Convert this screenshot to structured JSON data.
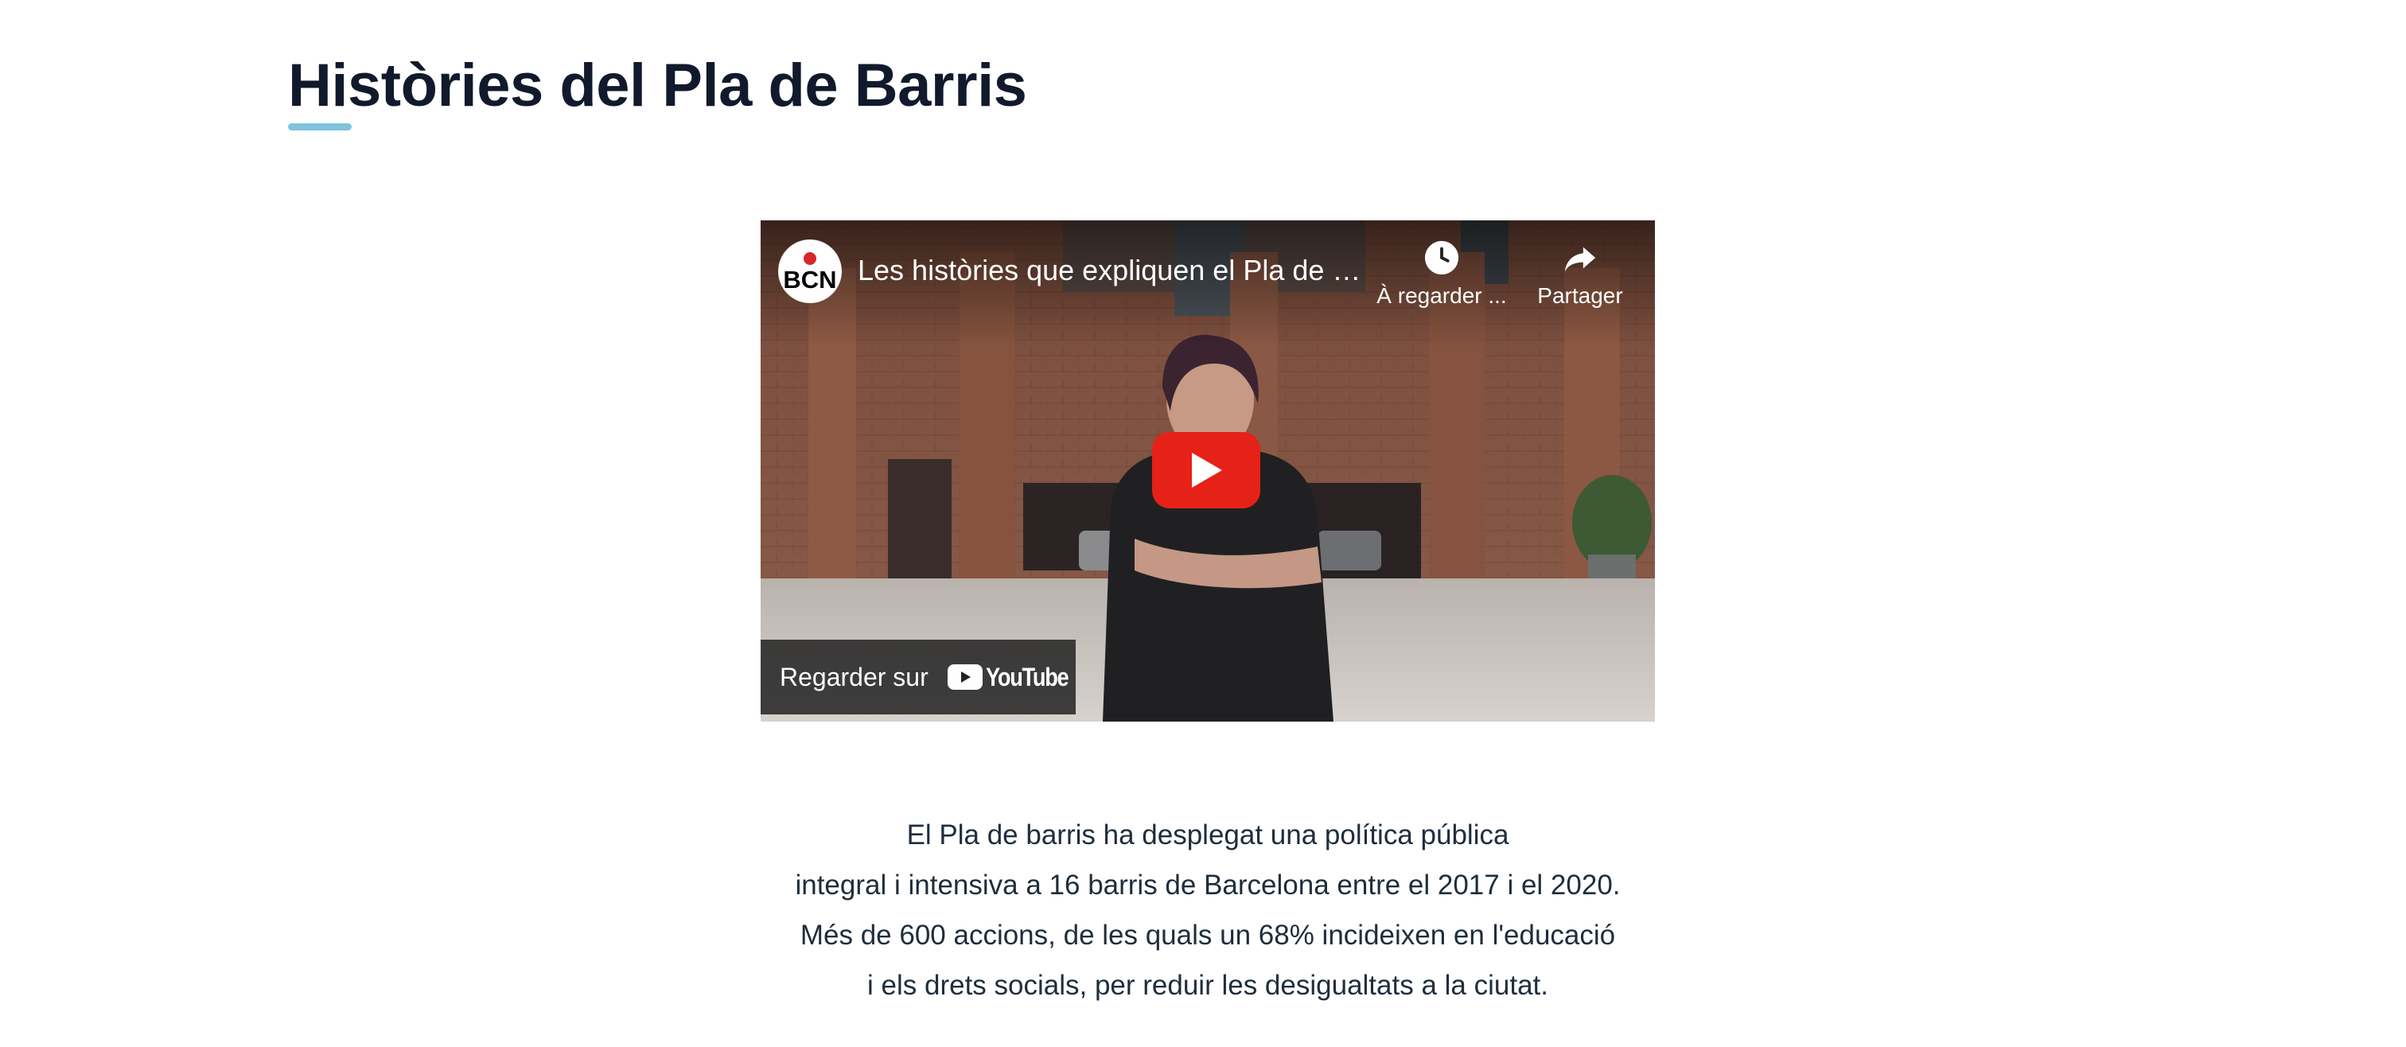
{
  "page": {
    "title": "Històries del Pla de Barris",
    "accent_color": "#7fc3df"
  },
  "video": {
    "channel_logo_text": "BCN",
    "title": "Les històries que expliquen el Pla de barris",
    "watch_later_label": "À regarder ...",
    "share_label": "Partager",
    "watch_on_label": "Regarder sur",
    "platform_label": "YouTube",
    "play_icon": "play-icon",
    "play_button_color": "#e62117"
  },
  "description": {
    "lines": [
      "El Pla de barris ha desplegat una política pública",
      "integral i intensiva a 16 barris de Barcelona entre el 2017 i el 2020.",
      "Més de 600 accions, de les quals un 68% incideixen en l'educació",
      "i els drets socials, per reduir les desigualtats a la ciutat."
    ]
  }
}
